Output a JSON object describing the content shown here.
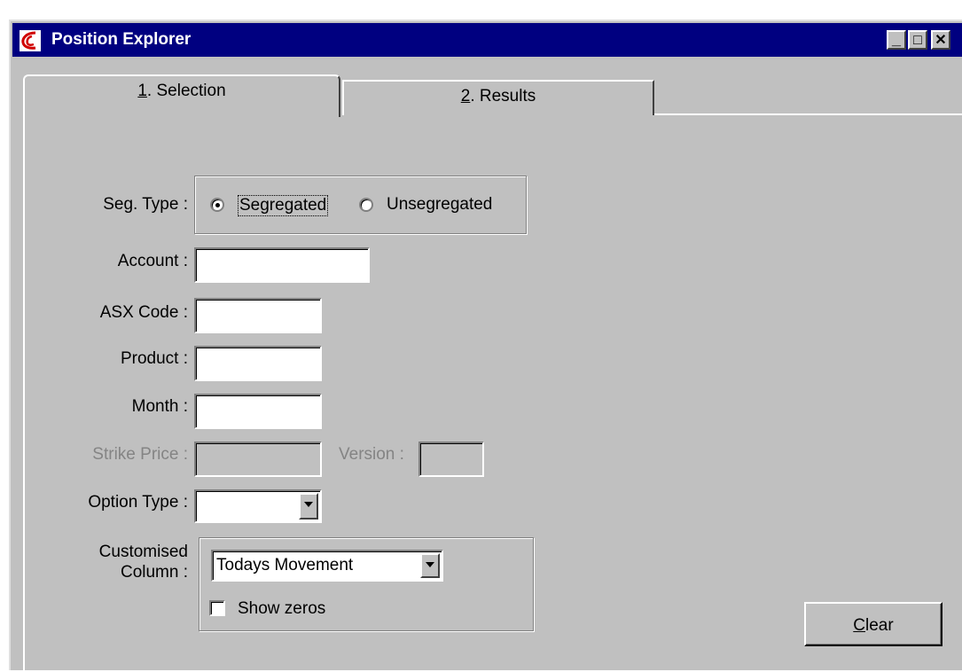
{
  "window": {
    "title": "Position Explorer",
    "controls": {
      "minimize": "_",
      "maximize": "□",
      "close": "✕"
    }
  },
  "tabs": [
    {
      "number": "1",
      "label": ". Selection",
      "selected": true
    },
    {
      "number": "2",
      "label": ". Results",
      "selected": false
    }
  ],
  "form": {
    "seg_type": {
      "label": "Seg. Type :",
      "options": [
        {
          "label": "Segregated",
          "selected": true
        },
        {
          "label": "Unsegregated",
          "selected": false
        }
      ]
    },
    "account": {
      "label": "Account :",
      "value": ""
    },
    "asx_code": {
      "label": "ASX Code :",
      "value": ""
    },
    "product": {
      "label": "Product :",
      "value": ""
    },
    "month": {
      "label": "Month :",
      "value": ""
    },
    "strike_price": {
      "label": "Strike Price :",
      "value": "",
      "disabled": true
    },
    "version": {
      "label": "Version :",
      "value": "",
      "disabled": true
    },
    "option_type": {
      "label": "Option Type :",
      "value": ""
    },
    "customised_column": {
      "label_line1": "Customised",
      "label_line2": "Column :",
      "value": "Todays Movement",
      "show_zeros": {
        "label": "Show zeros",
        "checked": false
      }
    }
  },
  "clear_button": {
    "mnemonic": "C",
    "label_rest": "lear"
  }
}
